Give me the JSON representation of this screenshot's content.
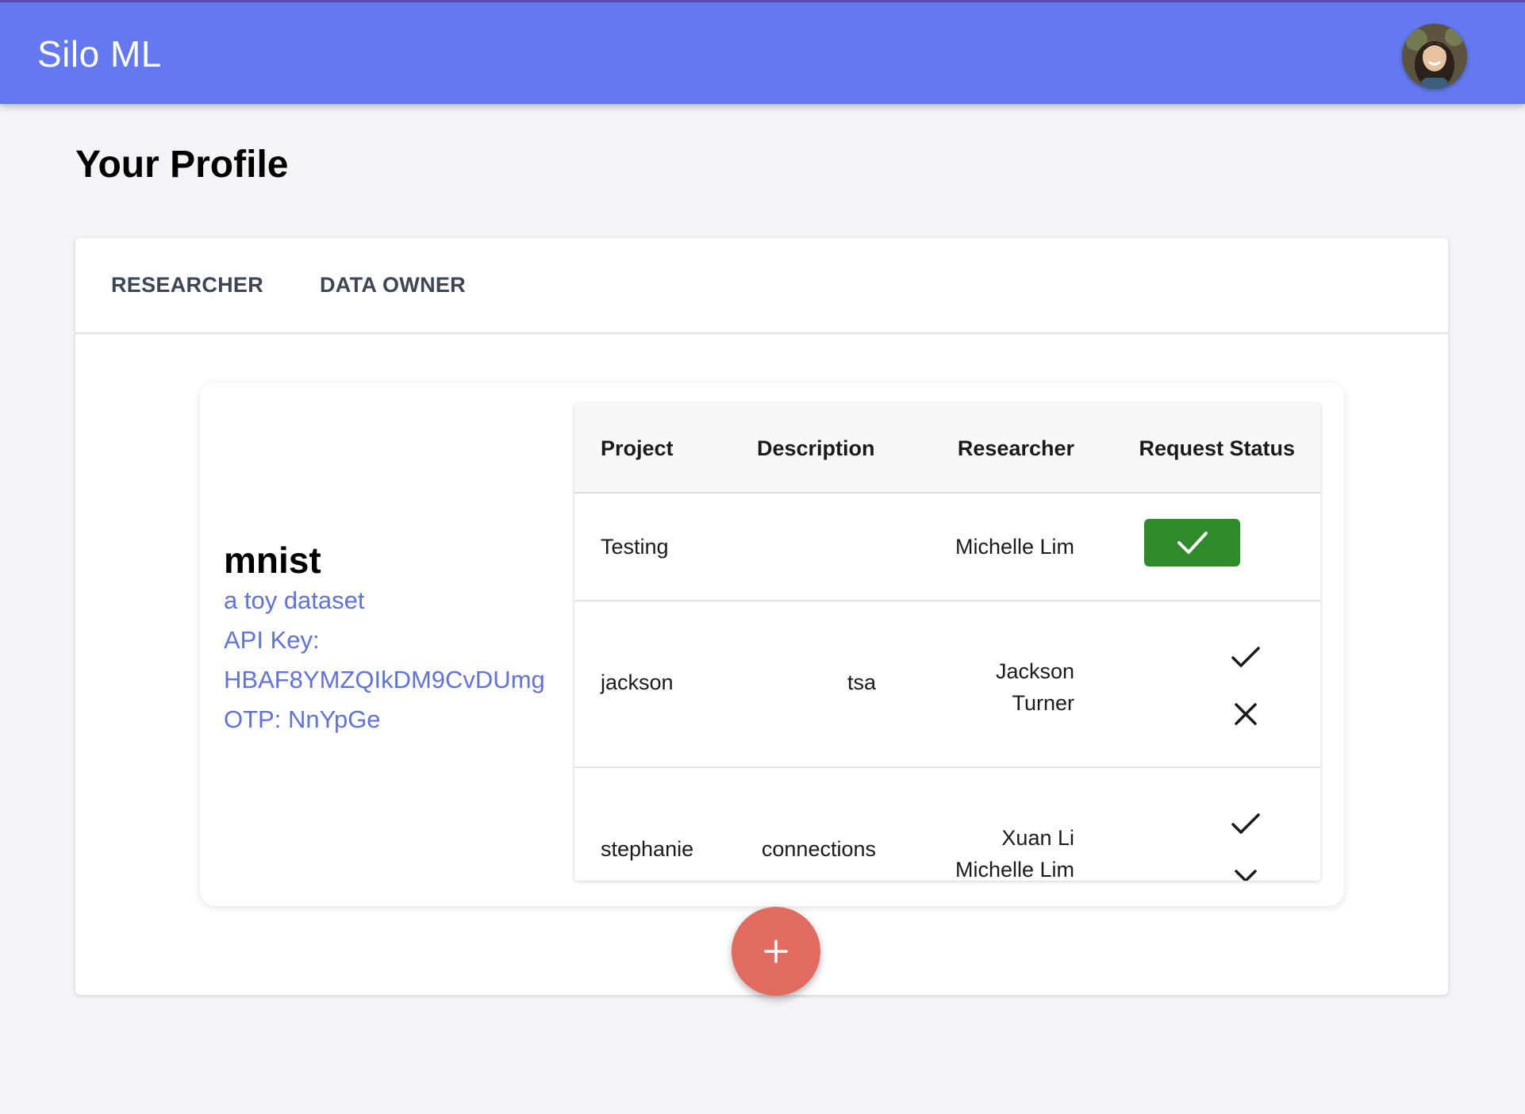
{
  "app": {
    "title": "Silo ML",
    "avatar_icon": "user-avatar"
  },
  "page": {
    "title": "Your Profile"
  },
  "tabs": [
    {
      "label": "RESEARCHER"
    },
    {
      "label": "DATA OWNER"
    }
  ],
  "dataset": {
    "name": "mnist",
    "description": "a toy dataset",
    "api_key_label": "API Key:",
    "api_key": "HBAF8YMZQIkDM9CvDUmg",
    "otp": "OTP: NnYpGe"
  },
  "table": {
    "headers": [
      "Project",
      "Description",
      "Researcher",
      "Request Status"
    ],
    "rows": [
      {
        "project": "Testing",
        "description": "",
        "researcher": "Michelle Lim",
        "researcher_line2": "",
        "status": "approved"
      },
      {
        "project": "jackson",
        "description": "tsa",
        "researcher": "Jackson",
        "researcher_line2": "Turner",
        "status": "pending"
      },
      {
        "project": "stephanie",
        "description": "connections",
        "researcher": "Xuan Li",
        "researcher_line2": "Michelle Lim",
        "status": "pending"
      }
    ]
  },
  "colors": {
    "appbar": "#6479ef",
    "accent_text": "#5e72e4",
    "approved": "#2f8a2a",
    "fab": "#e26b60"
  },
  "icons": {
    "approved": "check-icon",
    "approve": "check-icon",
    "reject": "close-icon",
    "fab": "plus-icon"
  }
}
